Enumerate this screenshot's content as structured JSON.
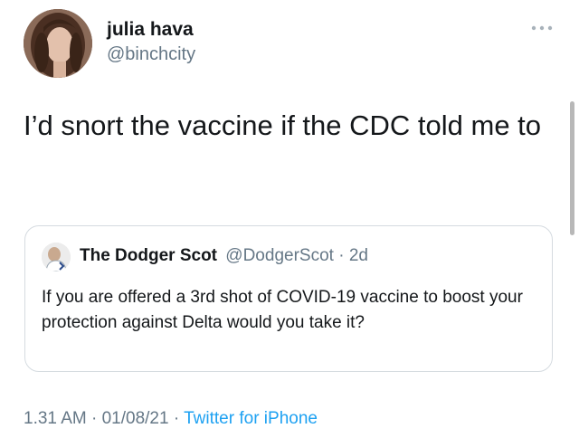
{
  "tweet": {
    "author": {
      "display_name": "julia hava",
      "handle": "@binchcity",
      "avatar_icon": "profile-photo"
    },
    "more_icon": "more-options-icon",
    "text": "I’d snort the vaccine if the CDC told me to",
    "quoted": {
      "display_name": "The Dodger Scot",
      "handle": "@DodgerScot",
      "separator": "·",
      "time": "2d",
      "text": "If you are offered a 3rd shot of COVID-19  vaccine to boost your protection against Delta would you take it?",
      "avatar_icon": "profile-photo"
    },
    "meta": {
      "time": "1.31 AM",
      "sep1": " · ",
      "date": "01/08/21",
      "sep2": " · ",
      "source": "Twitter for iPhone"
    }
  },
  "colors": {
    "text_primary": "#14171a",
    "text_secondary": "#657786",
    "link": "#1da1f2",
    "border": "#d5dbe0"
  }
}
